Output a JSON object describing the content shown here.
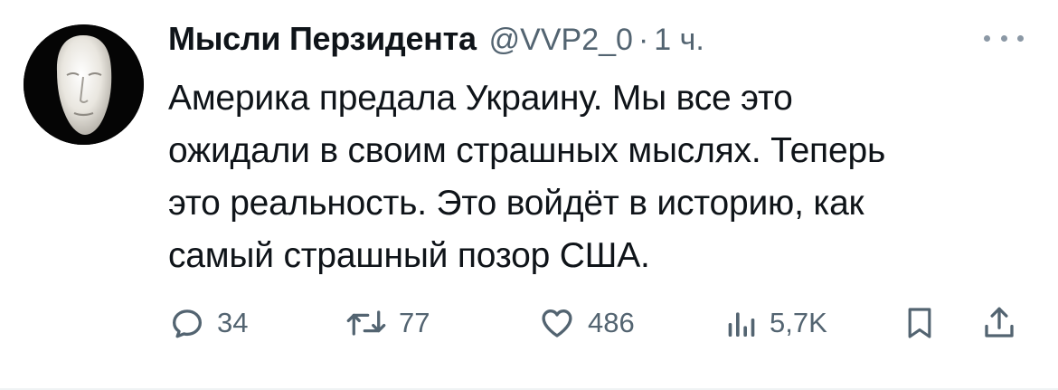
{
  "author": {
    "name": "Мысли Перзидента",
    "handle": "@VVP2_0",
    "separator": "·",
    "time": "1 ч."
  },
  "avatar": {
    "icon": "face-mask-avatar",
    "background": "#050505"
  },
  "tweet": {
    "lines": [
      "Америка предала Украину. Мы все это",
      "ожидали в своим страшных мыслях. Теперь",
      "это реальность. Это войдёт в историю, как",
      "самый страшный позор США."
    ]
  },
  "actions": {
    "reply": {
      "icon": "reply-icon",
      "count": "34"
    },
    "retweet": {
      "icon": "retweet-icon",
      "count": "77"
    },
    "like": {
      "icon": "heart-icon",
      "count": "486"
    },
    "views": {
      "icon": "views-icon",
      "count": "5,7K"
    },
    "bookmark": {
      "icon": "bookmark-icon"
    },
    "share": {
      "icon": "share-icon"
    }
  },
  "colors": {
    "text": "#0f1419",
    "secondary": "#536471",
    "icon": "#536471"
  }
}
